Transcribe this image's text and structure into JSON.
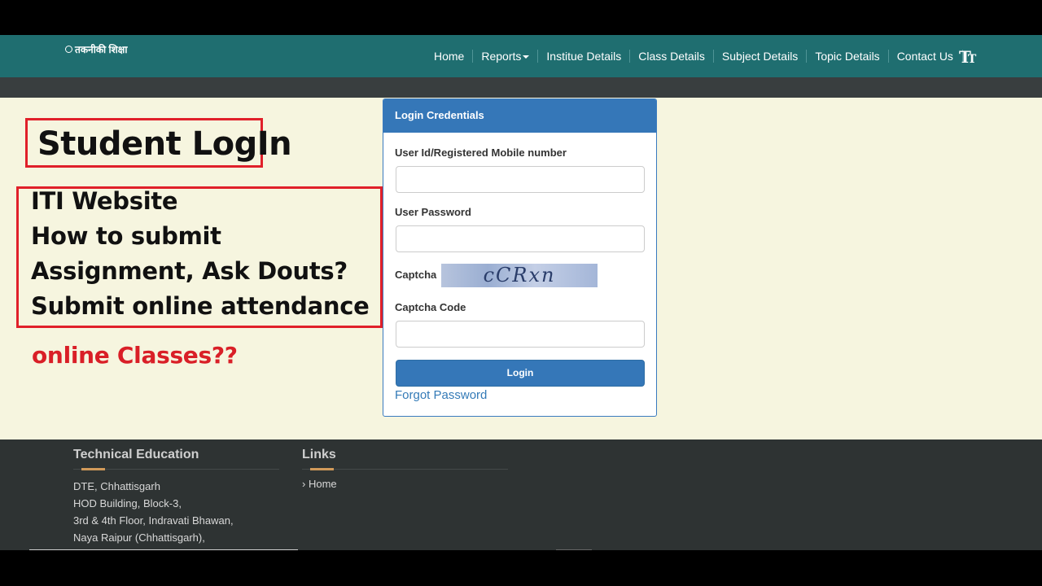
{
  "header": {
    "logo_text": "तकनीकी शिक्षा",
    "nav": [
      {
        "label": "Home"
      },
      {
        "label": "Reports"
      },
      {
        "label": "Institue Details"
      },
      {
        "label": "Class Details"
      },
      {
        "label": "Subject Details"
      },
      {
        "label": "Topic Details"
      },
      {
        "label": "Contact Us"
      }
    ],
    "font_size_icon": "font-size-icon"
  },
  "overlay": {
    "title": "Student LogIn",
    "lines": [
      "ITI Website",
      "How to submit",
      "Assignment, Ask Douts?",
      "Submit online attendance"
    ],
    "note": "online Classes??"
  },
  "login": {
    "panel_title": "Login Credentials",
    "user_id_label": "User Id/Registered Mobile number",
    "user_id_value": "",
    "password_label": "User Password",
    "password_value": "",
    "captcha_label": "Captcha",
    "captcha_text": "cCRxn",
    "captcha_code_label": "Captcha Code",
    "captcha_code_value": "",
    "login_button": "Login",
    "forgot_password": "Forgot Password"
  },
  "footer": {
    "col1_heading": "Technical Education",
    "address_lines": [
      "DTE, Chhattisgarh",
      "HOD Building, Block-3,",
      "3rd & 4th Floor, Indravati Bhawan,",
      "Naya Raipur (Chhattisgarh),"
    ],
    "col2_heading": "Links",
    "links": [
      {
        "label": "Home"
      }
    ]
  },
  "colors": {
    "navbar": "#1f6e70",
    "panel_header": "#3577b8",
    "highlight_red": "#e0202a",
    "page_bg": "#f6f5df",
    "footer_bg": "#2e3333"
  }
}
